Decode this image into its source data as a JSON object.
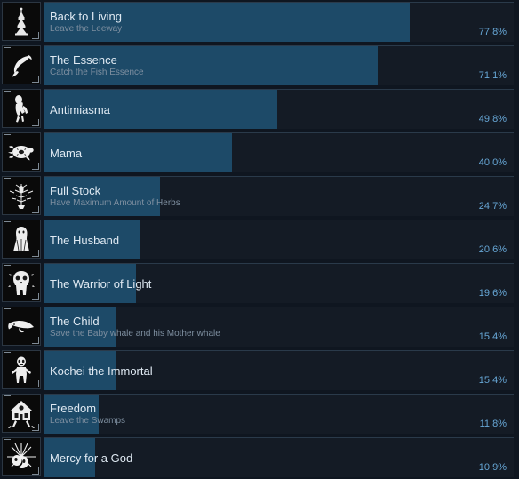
{
  "theme": {
    "page_background": "#0f1620",
    "track_background": "#141b25",
    "bar_fill": "#1d4a68",
    "title_color": "#dfe9f2",
    "description_color": "#7e8fa0",
    "percent_color": "#67a7d6"
  },
  "achievements": [
    {
      "title": "Back to Living",
      "description": "Leave the Leeway",
      "percent_label": "77.8%",
      "percent_value": 77.8,
      "icon": "lighthouse-tower-icon"
    },
    {
      "title": "The Essence",
      "description": "Catch the Fish Essence",
      "percent_label": "71.1%",
      "percent_value": 71.1,
      "icon": "fish-icon"
    },
    {
      "title": "Antimiasma",
      "description": "",
      "percent_label": "49.8%",
      "percent_value": 49.8,
      "icon": "creature-figure-icon"
    },
    {
      "title": "Mama",
      "description": "",
      "percent_label": "40.0%",
      "percent_value": 40.0,
      "icon": "turtle-icon"
    },
    {
      "title": "Full Stock",
      "description": "Have Maximum Amount of Herbs",
      "percent_label": "24.7%",
      "percent_value": 24.7,
      "icon": "herb-plant-icon"
    },
    {
      "title": "The Husband",
      "description": "",
      "percent_label": "20.6%",
      "percent_value": 20.6,
      "icon": "hooded-figure-icon"
    },
    {
      "title": "The Warrior of Light",
      "description": "",
      "percent_label": "19.6%",
      "percent_value": 19.6,
      "icon": "warrior-skull-icon"
    },
    {
      "title": "The Child",
      "description": "Save the Baby whale and his Mother whale",
      "percent_label": "15.4%",
      "percent_value": 15.4,
      "icon": "whale-icon"
    },
    {
      "title": "Kochei the Immortal",
      "description": "",
      "percent_label": "15.4%",
      "percent_value": 15.4,
      "icon": "skeleton-figure-icon"
    },
    {
      "title": "Freedom",
      "description": "Leave the Swamps",
      "percent_label": "11.8%",
      "percent_value": 11.8,
      "icon": "hut-on-legs-icon"
    },
    {
      "title": "Mercy for a God",
      "description": "",
      "percent_label": "10.9%",
      "percent_value": 10.9,
      "icon": "radiant-idol-icon"
    }
  ]
}
